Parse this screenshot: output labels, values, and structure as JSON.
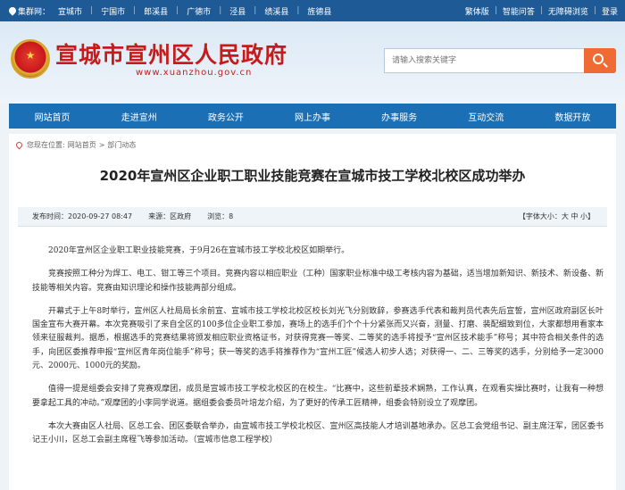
{
  "topbar": {
    "group_label": "集群网：",
    "sites": [
      "宣城市",
      "宁国市",
      "郎溪县",
      "广德市",
      "泾县",
      "绩溪县",
      "旌德县"
    ],
    "traditional": "繁体版",
    "accessibility": "智能问答",
    "barrier_free": "无障碍浏览",
    "login": "登录"
  },
  "header": {
    "title": "宣城市宣州区人民政府",
    "domain": "www.xuanzhou.gov.cn",
    "search_placeholder": "请输入搜索关键字",
    "emblem_star": "★"
  },
  "nav": {
    "items": [
      "网站首页",
      "走进宣州",
      "政务公开",
      "网上办事",
      "办事服务",
      "互动交流",
      "数据开放"
    ]
  },
  "breadcrumb": {
    "current_label": "您现在位置:",
    "home": "网站首页",
    "sep": ">",
    "section": "部门动态"
  },
  "article": {
    "title": "2020年宣州区企业职工职业技能竞赛在宣城市技工学校北校区成功举办",
    "publish_time": "发布时间：2020-09-27 08:47",
    "source": "来源：区政府",
    "views": "浏览：8",
    "font_size_label": "【字体大小：大  中  小】",
    "paragraphs": [
      "2020年宣州区企业职工职业技能竞赛，于9月26在宣城市技工学校北校区如期举行。",
      "竞赛按照工种分为焊工、电工、钳工等三个项目。竞赛内容以相应职业（工种）国家职业标准中级工考核内容为基础，适当增加新知识、新技术、新设备、新技能等相关内容。竞赛由知识理论和操作技能两部分组成。",
      "开幕式于上午8时举行，宣州区人社局局长余前宣、宣城市技工学校北校区校长刘光飞分别致辞，参赛选手代表和裁判员代表先后宣誓，宣州区政府副区长叶国金宣布大赛开幕。本次竞赛吸引了来自全区的100多位企业职工参加，赛场上的选手们个个十分紧张而又兴奋，测量、打磨、装配细致到位，大家都想用看家本领来征服裁判。据悉，根据选手的竞赛结果将颁发相应职业资格证书，对获得竞赛一等奖、二等奖的选手将授予“宣州区技术能手”称号；其中符合相关条件的选手，向团区委推荐申报“宣州区青年岗位能手”称号；获一等奖的选手将推荐作为“宣州工匠”候选人初步人选；对获得一、二、三等奖的选手，分别给予一定3000元、2000元、1000元的奖励。",
      "值得一提是组委会安排了竞赛观摩团，成员是宣城市技工学校北校区的在校生。“比赛中，这些前辈技术娴熟，工作认真，在观看实操比赛时，让我有一种想要拿起工具的冲动。”观摩团的小李同学说道。据组委会委员叶培龙介绍，为了更好的传承工匠精神，组委会特别设立了观摩团。",
      "本次大赛由区人社局、区总工会、团区委联合举办，由宣城市技工学校北校区、宣州区高技能人才培训基地承办。区总工会党组书记、副主席汪军，团区委书记王小川，区总工会副主席程飞等参加活动。（宣城市信息工程学校）"
    ]
  }
}
